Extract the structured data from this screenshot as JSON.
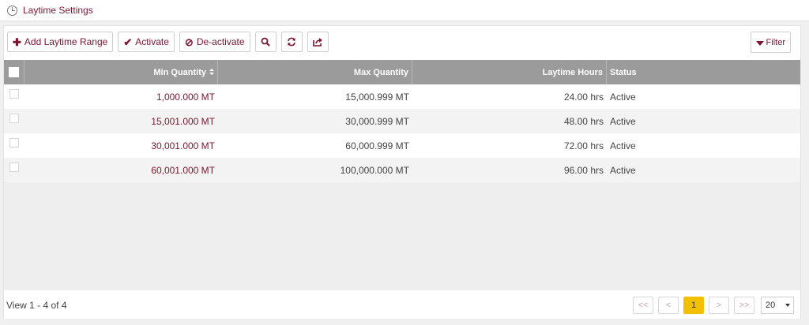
{
  "page": {
    "title": "Laytime Settings"
  },
  "toolbar": {
    "add_label": "Add Laytime Range",
    "activate_label": "Activate",
    "deactivate_label": "De-activate",
    "filter_label": "Filter"
  },
  "grid": {
    "columns": {
      "min": "Min Quantity",
      "max": "Max Quantity",
      "hours": "Laytime Hours",
      "status": "Status"
    },
    "rows": [
      {
        "min": "1,000.000 MT",
        "max": "15,000.999 MT",
        "hours": "24.00 hrs",
        "status": "Active"
      },
      {
        "min": "15,001.000 MT",
        "max": "30,000.999 MT",
        "hours": "48.00 hrs",
        "status": "Active"
      },
      {
        "min": "30,001.000 MT",
        "max": "60,000.999 MT",
        "hours": "72.00 hrs",
        "status": "Active"
      },
      {
        "min": "60,001.000 MT",
        "max": "100,000.000 MT",
        "hours": "96.00 hrs",
        "status": "Active"
      }
    ]
  },
  "footer": {
    "view_text": "View 1 - 4 of 4",
    "first": "<<",
    "prev": "<",
    "page": "1",
    "next": ">",
    "last": ">>",
    "page_size": "20"
  },
  "icons": {
    "header": "clock-icon",
    "add": "plus-icon",
    "activate": "check-icon",
    "deactivate": "ban-icon",
    "search": "search-icon",
    "refresh": "refresh-icon",
    "export": "export-icon",
    "filter": "funnel-icon"
  },
  "colors": {
    "accent": "#7a1630",
    "grid_header": "#9b9b9b",
    "current_page": "#f3c000"
  }
}
